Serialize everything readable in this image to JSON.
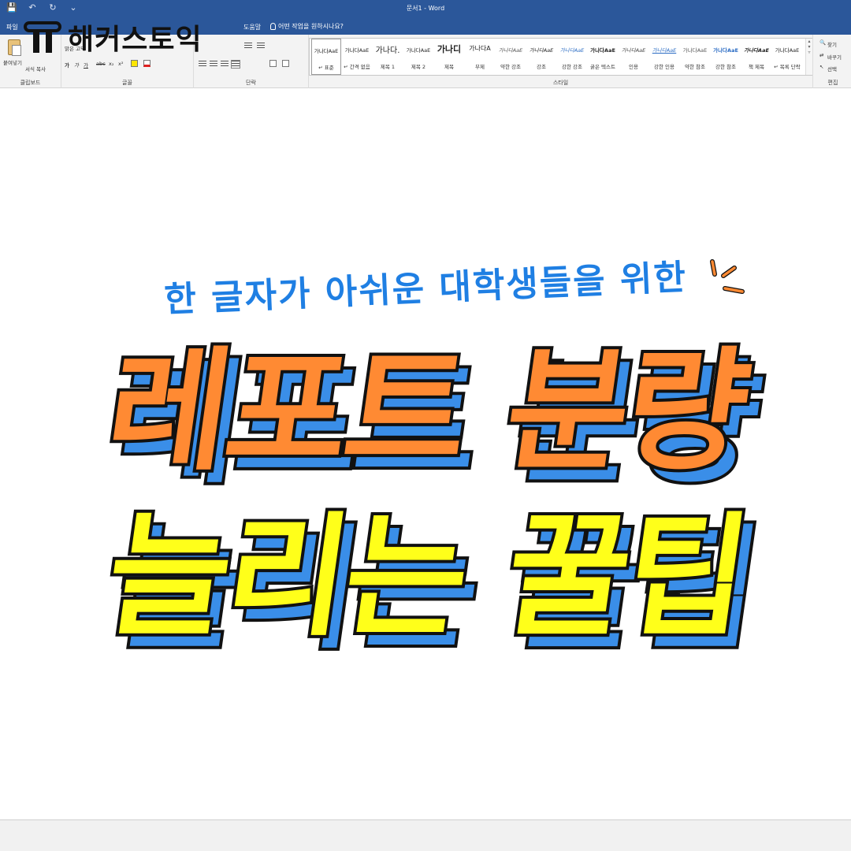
{
  "window": {
    "title": "문서1 - Word",
    "quick_access": [
      "💾",
      "↶",
      "↻",
      "⌄"
    ]
  },
  "menu": {
    "tabs": [
      "파일",
      "도움말"
    ],
    "tell_me": "어떤 작업을 원하시나요?"
  },
  "logo": {
    "text": "해커스토익"
  },
  "ribbon": {
    "clipboard": {
      "paste": "붙여넣기",
      "format_painter": "서식 복사",
      "label": "클립보드"
    },
    "font": {
      "label": "글꼴",
      "name": "맑은 고딕",
      "buttons": [
        "가",
        "가",
        "가",
        "abc",
        "x₂",
        "x²"
      ]
    },
    "paragraph": {
      "label": "단락"
    },
    "styles": {
      "label": "스타일",
      "items": [
        {
          "preview": "가나다AaE",
          "name": "↵ 표준"
        },
        {
          "preview": "가나다AaE",
          "name": "↵ 간격 없음"
        },
        {
          "preview": "가나다.",
          "name": "제목 1"
        },
        {
          "preview": "가나다AaE",
          "name": "제목 2"
        },
        {
          "preview": "가나디",
          "name": "제목"
        },
        {
          "preview": "가나다A",
          "name": "부제"
        },
        {
          "preview": "가나다AaE",
          "name": "약한 강조"
        },
        {
          "preview": "가나다AaE",
          "name": "강조"
        },
        {
          "preview": "가나다AaE",
          "name": "강한 강조"
        },
        {
          "preview": "가나다AaE",
          "name": "굵은 텍스트"
        },
        {
          "preview": "가나다AaE",
          "name": "인용"
        },
        {
          "preview": "가나다AaE",
          "name": "강한 인용"
        },
        {
          "preview": "가나다AaE",
          "name": "약한 참조"
        },
        {
          "preview": "가나다AaE",
          "name": "강한 참조"
        },
        {
          "preview": "가나다AaE",
          "name": "책 제목"
        },
        {
          "preview": "가나다AaE",
          "name": "↵ 목록 단락"
        }
      ]
    },
    "editing": {
      "label": "편집",
      "find": "찾기",
      "replace": "바꾸기",
      "select": "선택"
    }
  },
  "document": {
    "subtitle": "한 글자가 아쉬운 대학생들을 위한",
    "headline_line1": "레포트 분량",
    "headline_line2": "늘리는 꿀팁"
  },
  "colors": {
    "word_blue": "#2b579a",
    "subtitle_blue": "#1f7fe3",
    "headline_orange": "#ff8a33",
    "headline_yellow": "#ffff1a",
    "shadow_blue": "#3a8ee8"
  }
}
